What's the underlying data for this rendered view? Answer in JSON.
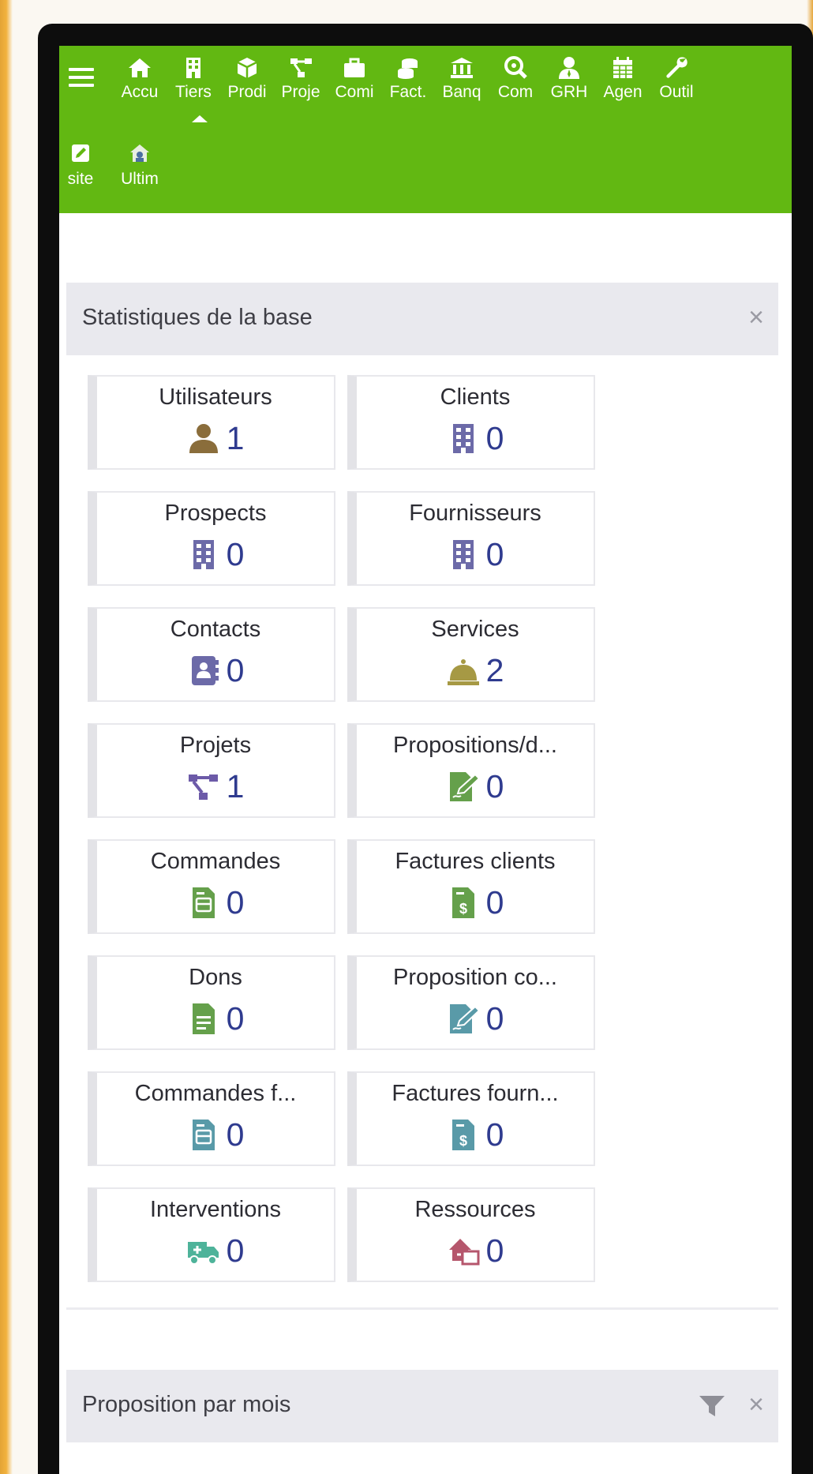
{
  "nav": {
    "items": [
      {
        "label": "Accu",
        "icon": "home-icon"
      },
      {
        "label": "Tiers",
        "icon": "building-icon"
      },
      {
        "label": "Prodi",
        "icon": "cube-icon"
      },
      {
        "label": "Proje",
        "icon": "project-icon"
      },
      {
        "label": "Comi",
        "icon": "briefcase-icon"
      },
      {
        "label": "Fact.",
        "icon": "coins-icon"
      },
      {
        "label": "Banq",
        "icon": "bank-icon"
      },
      {
        "label": "Com",
        "icon": "search-dollar-icon"
      },
      {
        "label": "GRH",
        "icon": "user-tie-icon"
      },
      {
        "label": "Agen",
        "icon": "calendar-icon"
      },
      {
        "label": "Outil",
        "icon": "wrench-icon"
      }
    ],
    "row2": [
      {
        "label": "site",
        "icon": "edit-icon"
      },
      {
        "label": "Ultim",
        "icon": "ultimate-icon"
      }
    ]
  },
  "stats_panel": {
    "title": "Statistiques de la base",
    "close": "×",
    "boxes": [
      {
        "label": "Utilisateurs",
        "value": "1",
        "icon": "user-icon",
        "color": "#8a6d3b"
      },
      {
        "label": "Clients",
        "value": "0",
        "icon": "building-icon",
        "color": "#6c6aa8"
      },
      {
        "label": "Prospects",
        "value": "0",
        "icon": "building-icon",
        "color": "#6c6aa8"
      },
      {
        "label": "Fournisseurs",
        "value": "0",
        "icon": "building-icon",
        "color": "#6c6aa8"
      },
      {
        "label": "Contacts",
        "value": "0",
        "icon": "address-book-icon",
        "color": "#6c6aa8"
      },
      {
        "label": "Services",
        "value": "2",
        "icon": "concierge-bell-icon",
        "color": "#a69944"
      },
      {
        "label": "Projets",
        "value": "1",
        "icon": "project-icon",
        "color": "#6c5aa8"
      },
      {
        "label": "Propositions/d...",
        "value": "0",
        "icon": "file-signature-icon",
        "color": "#65a04b"
      },
      {
        "label": "Commandes",
        "value": "0",
        "icon": "file-order-icon",
        "color": "#65a04b"
      },
      {
        "label": "Factures clients",
        "value": "0",
        "icon": "file-invoice-icon",
        "color": "#65a04b"
      },
      {
        "label": "Dons",
        "value": "0",
        "icon": "file-donation-icon",
        "color": "#65a04b"
      },
      {
        "label": "Proposition co...",
        "value": "0",
        "icon": "file-signature-icon",
        "color": "#599aa8"
      },
      {
        "label": "Commandes f...",
        "value": "0",
        "icon": "file-order-icon",
        "color": "#599aa8"
      },
      {
        "label": "Factures fourn...",
        "value": "0",
        "icon": "file-invoice-icon",
        "color": "#599aa8"
      },
      {
        "label": "Interventions",
        "value": "0",
        "icon": "truck-icon",
        "color": "#4eb39a"
      },
      {
        "label": "Ressources",
        "value": "0",
        "icon": "resource-icon",
        "color": "#b5566c"
      }
    ]
  },
  "proposal_panel": {
    "title": "Proposition par mois",
    "close": "×"
  }
}
